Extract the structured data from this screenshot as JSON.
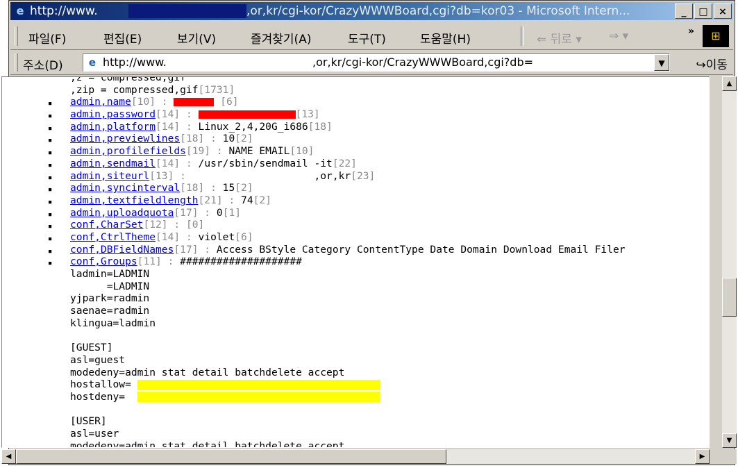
{
  "window": {
    "title_left": "http://www.",
    "title_right": ",or,kr/cgi-kor/CrazyWWWBoard,cgi?db=kor03 - Microsoft Intern...",
    "controls": [
      "_",
      "□",
      "×"
    ]
  },
  "menu": {
    "file": "파일(F)",
    "edit": "편집(E)",
    "view": "보기(V)",
    "favorites": "즐겨찾기(A)",
    "tools": "도구(T)",
    "help": "도움말(H)",
    "back": "⇐ 뒤로 ▾",
    "forward": "⇒ ▾",
    "more": "»"
  },
  "address": {
    "label": "주소(D)",
    "url_left": "http://www.",
    "url_right": ",or,kr/cgi-kor/CrazyWWWBoard,cgi?db=",
    "go": "이동"
  },
  "content": {
    "top_partial": ",z = compressed,gif",
    "zip_line": ",zip = compressed,gif",
    "zip_count": "[1731]",
    "entries": [
      {
        "key": "admin,name",
        "meta": "[10] :",
        "value": "",
        "tail": "[6]"
      },
      {
        "key": "admin,password",
        "meta": "[14] :",
        "value": "",
        "tail": "[13]"
      },
      {
        "key": "admin,platform",
        "meta": "[14] :",
        "value": "Linux_2,4,20G_i686",
        "tail": "[18]"
      },
      {
        "key": "admin,previewlines",
        "meta": "[18] :",
        "value": "10",
        "tail": "[2]"
      },
      {
        "key": "admin,profilefields",
        "meta": "[19] :",
        "value": "NAME EMAIL",
        "tail": "[10]"
      },
      {
        "key": "admin,sendmail",
        "meta": "[14] :",
        "value": "/usr/sbin/sendmail -it",
        "tail": "[22]"
      },
      {
        "key": "admin,siteurl",
        "meta": "[13] :",
        "value": "                    ,or,kr",
        "tail": "[23]"
      },
      {
        "key": "admin,syncinterval",
        "meta": "[18] :",
        "value": "15",
        "tail": "[2]"
      },
      {
        "key": "admin,textfieldlength",
        "meta": "[21] :",
        "value": "74",
        "tail": "[2]"
      },
      {
        "key": "admin,uploadquota",
        "meta": "[17] :",
        "value": "0",
        "tail": "[1]"
      },
      {
        "key": "conf,CharSet",
        "meta": "[12] :",
        "value": "",
        "tail": "[0]"
      },
      {
        "key": "conf,CtrlTheme",
        "meta": "[14] :",
        "value": "violet",
        "tail": "[6]"
      },
      {
        "key": "conf,DBFieldNames",
        "meta": "[17] :",
        "value": "Access BStyle Category ContentType Date Domain Download Email Filer",
        "tail": ""
      },
      {
        "key": "conf,Groups",
        "meta": "[11] :",
        "value": "####################",
        "tail": ""
      }
    ],
    "groups_text": [
      "ladmin=LADMIN",
      "      =LADMIN",
      "yjpark=radmin",
      "saenae=radmin",
      "klingua=ladmin",
      "",
      "[GUEST]",
      "asl=guest",
      "modedeny=admin stat detail batchdelete accept"
    ],
    "host_allow": "hostallow=",
    "host_deny": "hostdeny=",
    "user_text": [
      "",
      "[USER]",
      "asl=user",
      "modedeny=admin stat detail batchdelete accept"
    ]
  },
  "colors": {
    "redaction_red": "#ff0000",
    "redaction_yellow": "#ffff00",
    "link": "#0000ee"
  }
}
